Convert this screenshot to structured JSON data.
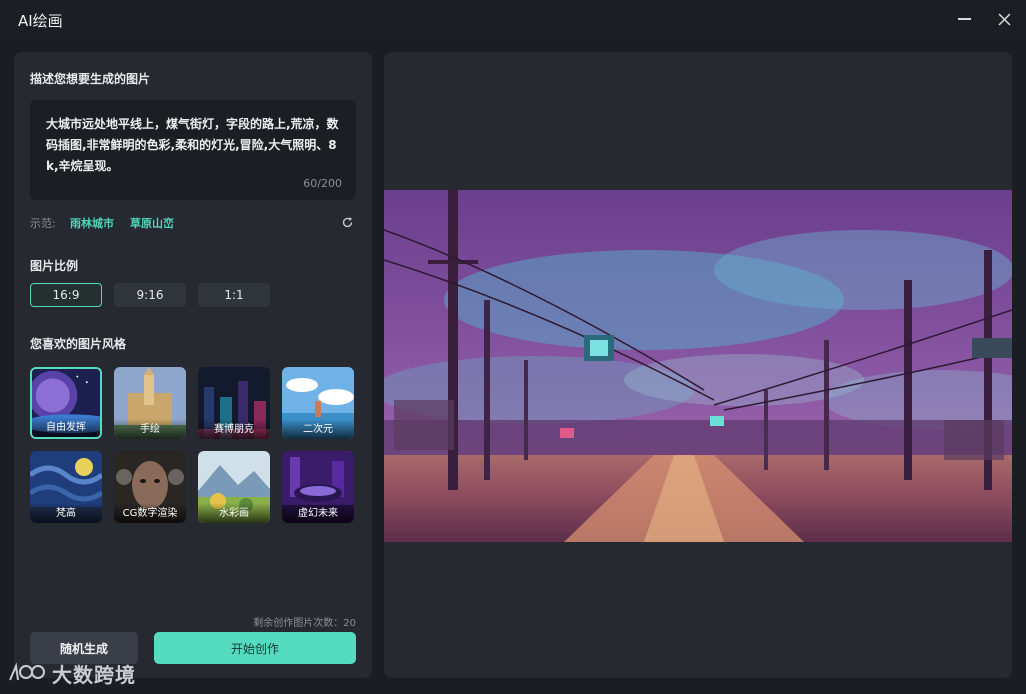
{
  "window": {
    "title": "AI绘画"
  },
  "prompt": {
    "label": "描述您想要生成的图片",
    "text": "大城市远处地平线上，煤气街灯，字段的路上,荒凉，数码插图,非常鲜明的色彩,柔和的灯光,冒险,大气照明、8k,辛烷呈现。",
    "count": "60/200"
  },
  "examples": {
    "label": "示范:",
    "items": [
      "雨林城市",
      "草原山峦"
    ]
  },
  "ratio": {
    "label": "图片比例",
    "options": [
      "16:9",
      "9:16",
      "1:1"
    ],
    "selected": "16:9"
  },
  "styles": {
    "label": "您喜欢的图片风格",
    "items": [
      "自由发挥",
      "手绘",
      "赛博朋克",
      "二次元",
      "梵高",
      "CG数字渲染",
      "水彩画",
      "虚幻未来"
    ],
    "selected": "自由发挥"
  },
  "footer": {
    "remaining": "剩余创作图片次数：20",
    "random_label": "随机生成",
    "start_label": "开始创作"
  },
  "watermark": {
    "text": "大数跨境"
  },
  "colors": {
    "accent": "#55dcc0",
    "panel": "#262a30",
    "background": "#1a1d21"
  }
}
